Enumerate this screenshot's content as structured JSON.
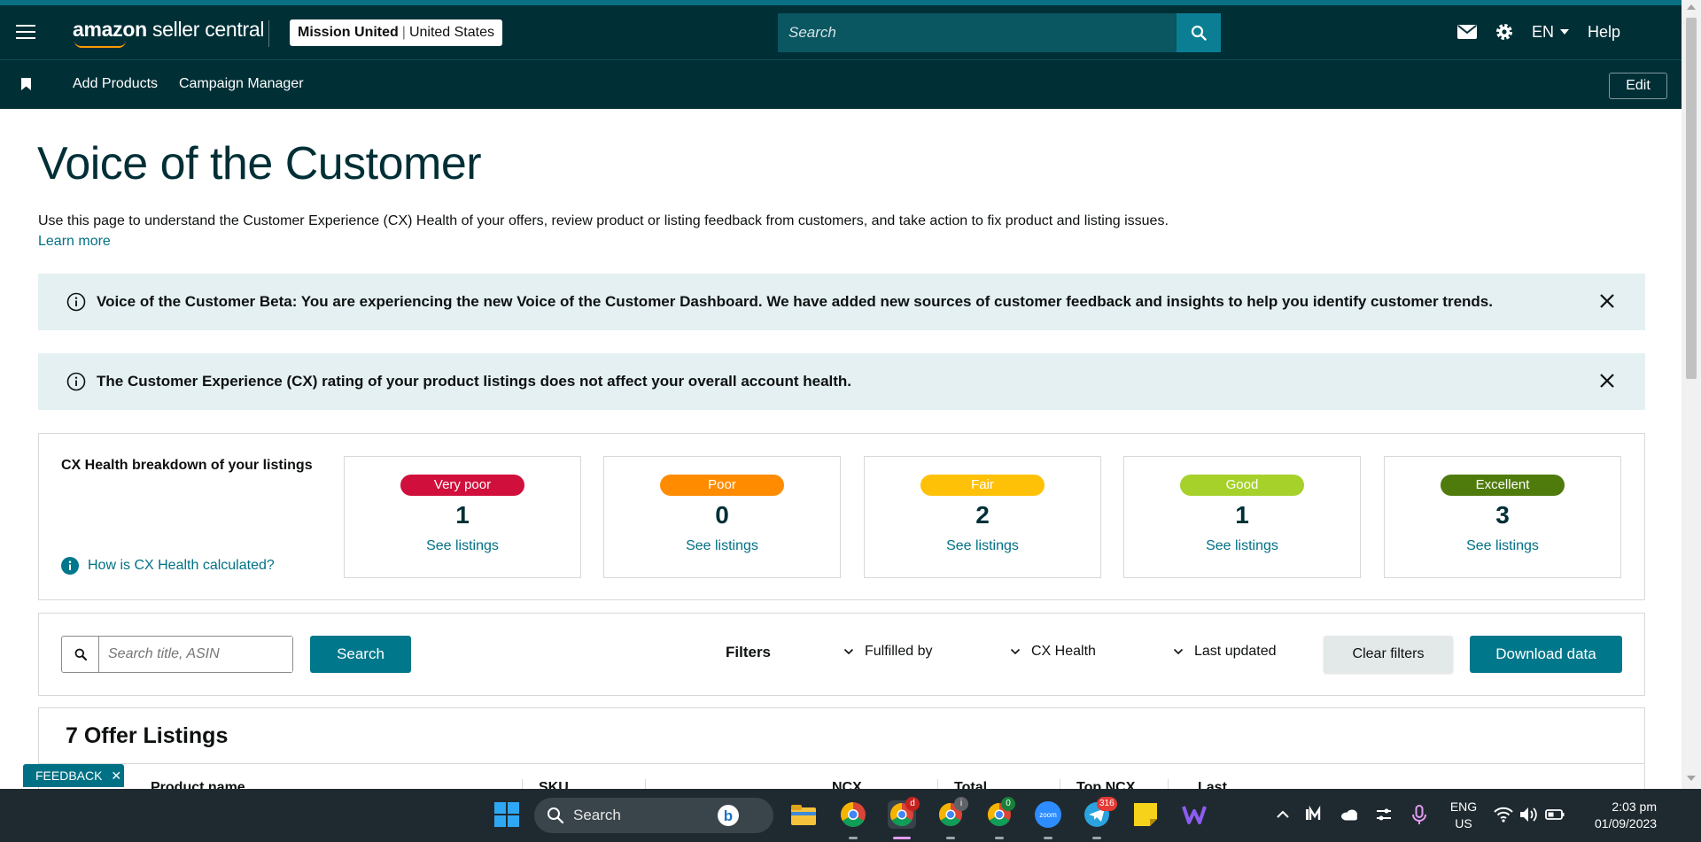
{
  "header": {
    "logo_amazon": "amazon",
    "logo_rest": "seller central",
    "account_name": "Mission United",
    "account_region": "United States",
    "search_placeholder": "Search",
    "language": "EN",
    "help": "Help"
  },
  "subnav": {
    "items": [
      "Add Products",
      "Campaign Manager"
    ],
    "edit": "Edit"
  },
  "page": {
    "title": "Voice of the Customer",
    "intro": "Use this page to understand the Customer Experience (CX) Health of your offers, review product or listing feedback from customers, and take action to fix product and listing issues.",
    "learn_more": "Learn more"
  },
  "alerts": [
    {
      "message": "Voice of the Customer Beta: You are experiencing the new Voice of the Customer Dashboard. We have added new sources of customer feedback and insights to help you identify customer trends."
    },
    {
      "message": "The Customer Experience (CX) rating of your product listings does not affect your overall account health."
    }
  ],
  "cx_health": {
    "title": "CX Health breakdown of your listings",
    "help_link": "How is CX Health calculated?",
    "cards": [
      {
        "label": "Very poor",
        "count": "1",
        "link": "See listings",
        "color": "#d00f3c"
      },
      {
        "label": "Poor",
        "count": "0",
        "link": "See listings",
        "color": "#ff8c00"
      },
      {
        "label": "Fair",
        "count": "2",
        "link": "See listings",
        "color": "#ffc107"
      },
      {
        "label": "Good",
        "count": "1",
        "link": "See listings",
        "color": "#a6d12b"
      },
      {
        "label": "Excellent",
        "count": "3",
        "link": "See listings",
        "color": "#4f7b0c"
      }
    ]
  },
  "filters": {
    "search_placeholder": "Search title, ASIN",
    "search_button": "Search",
    "label": "Filters",
    "dropdowns": [
      "Fulfilled by",
      "CX Health",
      "Last updated"
    ],
    "clear": "Clear filters",
    "download": "Download data"
  },
  "listings": {
    "title": "7 Offer Listings",
    "columns": [
      "Product name",
      "SKU",
      "NCX",
      "Total",
      "Top NCX",
      "Last"
    ]
  },
  "feedback_tab": "FEEDBACK",
  "taskbar": {
    "search": "Search",
    "lang_top": "ENG",
    "lang_bottom": "US",
    "time": "2:03 pm",
    "date": "01/09/2023",
    "telegram_badge": "316",
    "chrome2_badge": "d",
    "chrome3_badge": "i",
    "chrome4_badge": "0"
  },
  "colors": {
    "header_bg": "#002f36",
    "accent": "#00778b",
    "link": "#007185",
    "alert_bg": "#e4f0f2"
  }
}
